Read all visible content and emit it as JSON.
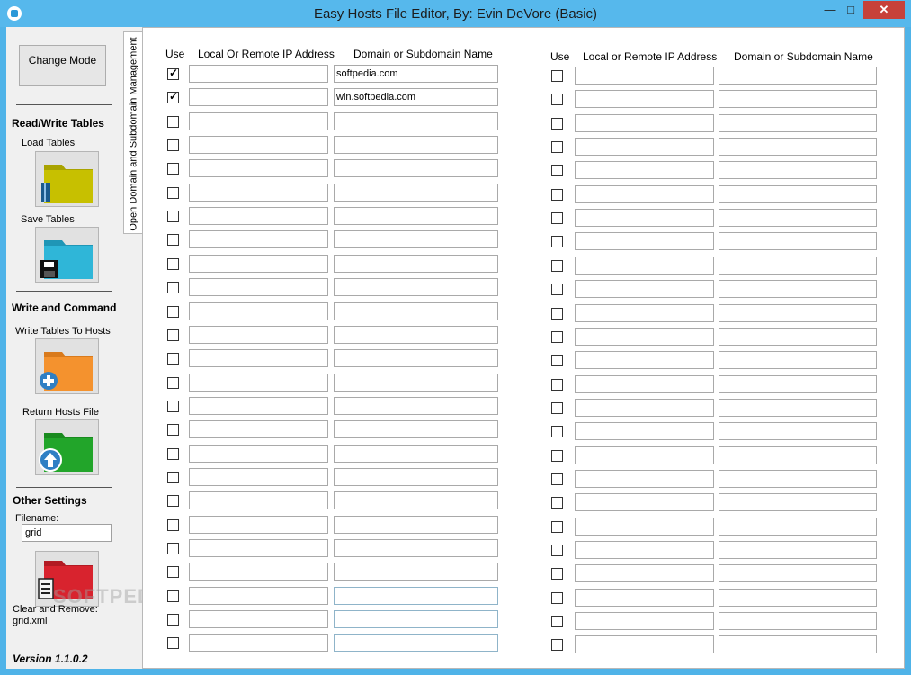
{
  "window": {
    "title": "Easy Hosts File Editor, By: Evin DeVore (Basic)",
    "minimize_glyph": "—",
    "maximize_glyph": "□",
    "close_glyph": "✕"
  },
  "sidebar": {
    "change_mode_label": "Change Mode",
    "read_write_title": "Read/Write Tables",
    "load_tables_label": "Load Tables",
    "save_tables_label": "Save Tables",
    "write_command_title": "Write and Command",
    "write_tables_label": "Write Tables To Hosts",
    "return_hosts_label": "Return Hosts File",
    "other_settings_title": "Other Settings",
    "filename_label": "Filename:",
    "filename_value": "grid",
    "clear_remove_label": "Clear and Remove:",
    "clear_remove_file": "grid.xml",
    "version": "Version  1.1.0.2",
    "icons": {
      "load": "yellow-folder-book-icon",
      "save": "cyan-folder-floppy-icon",
      "write": "orange-folder-plus-icon",
      "return": "green-folder-up-arrow-icon",
      "clear": "red-folder-document-icon"
    },
    "colors": {
      "load": "#c7c000",
      "save": "#2fb6d8",
      "write": "#f4922e",
      "return": "#22a52a",
      "clear": "#d8232e"
    }
  },
  "tab": {
    "label": "Open Domain and Subdomain Management"
  },
  "table_left": {
    "headers": {
      "use": "Use",
      "ip": "Local Or Remote IP Address",
      "domain": "Domain or Subdomain Name"
    },
    "rows": [
      {
        "checked": true,
        "ip": "",
        "domain": "softpedia.com"
      },
      {
        "checked": true,
        "ip": "",
        "domain": "win.softpedia.com"
      },
      {
        "checked": false,
        "ip": "",
        "domain": ""
      },
      {
        "checked": false,
        "ip": "",
        "domain": ""
      },
      {
        "checked": false,
        "ip": "",
        "domain": ""
      },
      {
        "checked": false,
        "ip": "",
        "domain": ""
      },
      {
        "checked": false,
        "ip": "",
        "domain": ""
      },
      {
        "checked": false,
        "ip": "",
        "domain": ""
      },
      {
        "checked": false,
        "ip": "",
        "domain": ""
      },
      {
        "checked": false,
        "ip": "",
        "domain": ""
      },
      {
        "checked": false,
        "ip": "",
        "domain": ""
      },
      {
        "checked": false,
        "ip": "",
        "domain": ""
      },
      {
        "checked": false,
        "ip": "",
        "domain": ""
      },
      {
        "checked": false,
        "ip": "",
        "domain": ""
      },
      {
        "checked": false,
        "ip": "",
        "domain": ""
      },
      {
        "checked": false,
        "ip": "",
        "domain": ""
      },
      {
        "checked": false,
        "ip": "",
        "domain": ""
      },
      {
        "checked": false,
        "ip": "",
        "domain": ""
      },
      {
        "checked": false,
        "ip": "",
        "domain": ""
      },
      {
        "checked": false,
        "ip": "",
        "domain": ""
      },
      {
        "checked": false,
        "ip": "",
        "domain": ""
      },
      {
        "checked": false,
        "ip": "",
        "domain": ""
      },
      {
        "checked": false,
        "ip": "",
        "domain": ""
      },
      {
        "checked": false,
        "ip": "",
        "domain": ""
      },
      {
        "checked": false,
        "ip": "",
        "domain": ""
      }
    ]
  },
  "table_right": {
    "headers": {
      "use": "Use",
      "ip": "Local or Remote IP Address",
      "domain": "Domain or Subdomain Name"
    },
    "rows": [
      {
        "checked": false,
        "ip": "",
        "domain": ""
      },
      {
        "checked": false,
        "ip": "",
        "domain": ""
      },
      {
        "checked": false,
        "ip": "",
        "domain": ""
      },
      {
        "checked": false,
        "ip": "",
        "domain": ""
      },
      {
        "checked": false,
        "ip": "",
        "domain": ""
      },
      {
        "checked": false,
        "ip": "",
        "domain": ""
      },
      {
        "checked": false,
        "ip": "",
        "domain": ""
      },
      {
        "checked": false,
        "ip": "",
        "domain": ""
      },
      {
        "checked": false,
        "ip": "",
        "domain": ""
      },
      {
        "checked": false,
        "ip": "",
        "domain": ""
      },
      {
        "checked": false,
        "ip": "",
        "domain": ""
      },
      {
        "checked": false,
        "ip": "",
        "domain": ""
      },
      {
        "checked": false,
        "ip": "",
        "domain": ""
      },
      {
        "checked": false,
        "ip": "",
        "domain": ""
      },
      {
        "checked": false,
        "ip": "",
        "domain": ""
      },
      {
        "checked": false,
        "ip": "",
        "domain": ""
      },
      {
        "checked": false,
        "ip": "",
        "domain": ""
      },
      {
        "checked": false,
        "ip": "",
        "domain": ""
      },
      {
        "checked": false,
        "ip": "",
        "domain": ""
      },
      {
        "checked": false,
        "ip": "",
        "domain": ""
      },
      {
        "checked": false,
        "ip": "",
        "domain": ""
      },
      {
        "checked": false,
        "ip": "",
        "domain": ""
      },
      {
        "checked": false,
        "ip": "",
        "domain": ""
      },
      {
        "checked": false,
        "ip": "",
        "domain": ""
      },
      {
        "checked": false,
        "ip": "",
        "domain": ""
      }
    ]
  },
  "watermark": "SOFTPEDIA"
}
